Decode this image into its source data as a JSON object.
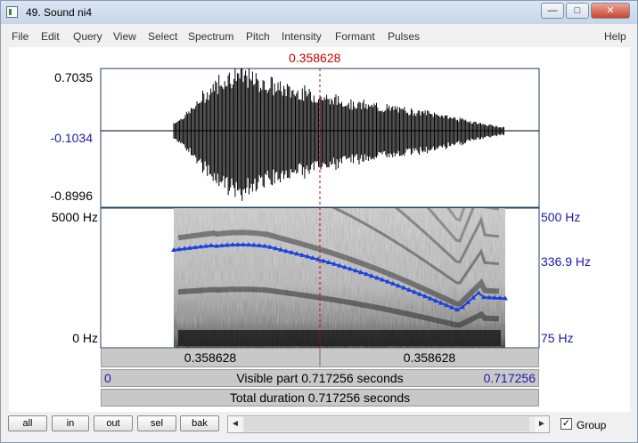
{
  "window": {
    "title": "49. Sound ni4",
    "controls": {
      "minimize": "—",
      "maximize": "□",
      "close": "✕"
    }
  },
  "menu": [
    "File",
    "Edit",
    "Query",
    "View",
    "Select",
    "Spectrum",
    "Pitch",
    "Intensity",
    "Formant",
    "Pulses",
    "Help"
  ],
  "cursor": {
    "time_label": "0.358628",
    "color": "#cc0000"
  },
  "waveform": {
    "top_label": "0.7035",
    "mid_label": "-0.1034",
    "bottom_label": "-0.8996"
  },
  "spectrogram": {
    "top_label": "5000 Hz",
    "bottom_label": "0 Hz",
    "pitch_top_label": "500 Hz",
    "pitch_mid_label": "336.9 Hz",
    "pitch_bottom_label": "75 Hz",
    "pitch_color": "#1a40e0"
  },
  "time_bar": {
    "left_label": "0.358628",
    "right_label": "0.358628"
  },
  "visible_bar": {
    "start": "0",
    "text": "Visible part 0.717256 seconds",
    "end": "0.717256"
  },
  "total_bar": {
    "text": "Total duration 0.717256 seconds"
  },
  "buttons": {
    "all": "all",
    "in": "in",
    "out": "out",
    "sel": "sel",
    "bak": "bak"
  },
  "scrollbar": {
    "left_arrow": "◄",
    "right_arrow": "►"
  },
  "group": {
    "label": "Group",
    "checked": "✓"
  }
}
